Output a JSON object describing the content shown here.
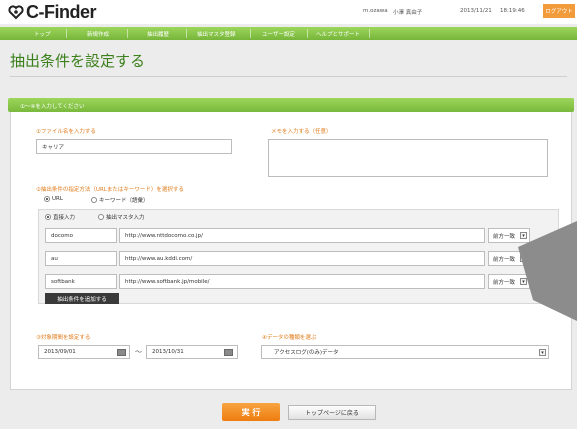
{
  "header": {
    "logo_text": "C-Finder",
    "user": "m.ozawa",
    "user_name": "小澤 真由子",
    "date": "2013/11/21",
    "time": "18:19:46",
    "logout_label": "ログアウト"
  },
  "nav": {
    "items": [
      {
        "label": "トップ"
      },
      {
        "label": "新規作成"
      },
      {
        "label": "抽出履歴"
      },
      {
        "label": "抽出マスタ登録"
      },
      {
        "label": "ユーザー設定"
      },
      {
        "label": "ヘルプとサポート"
      }
    ]
  },
  "page": {
    "title": "抽出条件を設定する",
    "section_label": "①～④を入力してください"
  },
  "file": {
    "label": "①ファイル名を入力する",
    "value": "キャリア",
    "memo_label": "メモを入力する（任意）",
    "memo_value": ""
  },
  "method": {
    "label": "②抽出条件の指定方法（URLまたはキーワード）を選択する",
    "options": [
      "URL",
      "キーワード（語彙）"
    ],
    "selected": "URL",
    "input_modes": [
      "直接入力",
      "抽出マスタ入力"
    ],
    "input_mode_selected": "直接入力"
  },
  "conditions": [
    {
      "name": "docomo",
      "url": "http://www.nttdocomo.co.jp/",
      "match": "前方一致"
    },
    {
      "name": "au",
      "url": "http://www.au.kddi.com/",
      "match": "前方一致"
    },
    {
      "name": "softbank",
      "url": "http://www.softbank.jp/mobile/",
      "match": "前方一致"
    }
  ],
  "add_condition_label": "抽出条件を追加する",
  "period": {
    "label": "③対象期間を設定する",
    "start": "2013/09/01",
    "end": "2013/10/31",
    "separator": "～"
  },
  "data_type": {
    "label": "④データの種類を選ぶ",
    "selected": "アクセスログ(のみ)データ"
  },
  "actions": {
    "run_label": "実 行",
    "back_label": "トップページに戻る"
  },
  "colors": {
    "nav_green": "#86c447",
    "title_green": "#3a7f1a",
    "accent_orange": "#ee7d10",
    "overlay_gray": "#8c8c8c"
  }
}
